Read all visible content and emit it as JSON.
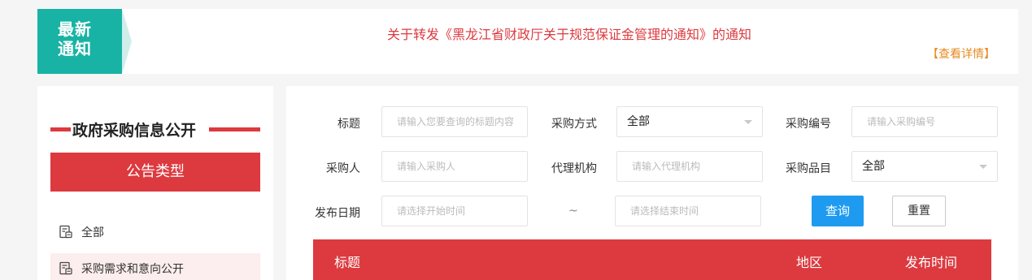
{
  "notice": {
    "badge_line1": "最新",
    "badge_line2": "通知",
    "title": "关于转发《黑龙江省财政厅关于规范保证金管理的通知》的通知",
    "more_link": "【查看详情】"
  },
  "sidebar": {
    "heading": "政府采购信息公开",
    "type_header": "公告类型",
    "items": [
      {
        "label": "全部"
      },
      {
        "label": "采购需求和意向公开"
      }
    ]
  },
  "filters": {
    "title_label": "标题",
    "title_placeholder": "请输入您要查询的标题内容",
    "method_label": "采购方式",
    "method_value": "全部",
    "code_label": "采购编号",
    "code_placeholder": "请输入采购编号",
    "buyer_label": "采购人",
    "buyer_placeholder": "请输入采购人",
    "agency_label": "代理机构",
    "agency_placeholder": "请输入代理机构",
    "category_label": "采购品目",
    "category_value": "全部",
    "date_label": "发布日期",
    "start_placeholder": "请选择开始时间",
    "date_separator": "~",
    "end_placeholder": "请选择结束时间",
    "query_button": "查询",
    "reset_button": "重置"
  },
  "table": {
    "columns": [
      "标题",
      "地区",
      "发布时间"
    ]
  },
  "colors": {
    "brand_red": "#dc3a3f",
    "notice_teal": "#18b3a4",
    "query_blue": "#1e9bf0",
    "more_orange": "#e68a1f"
  }
}
